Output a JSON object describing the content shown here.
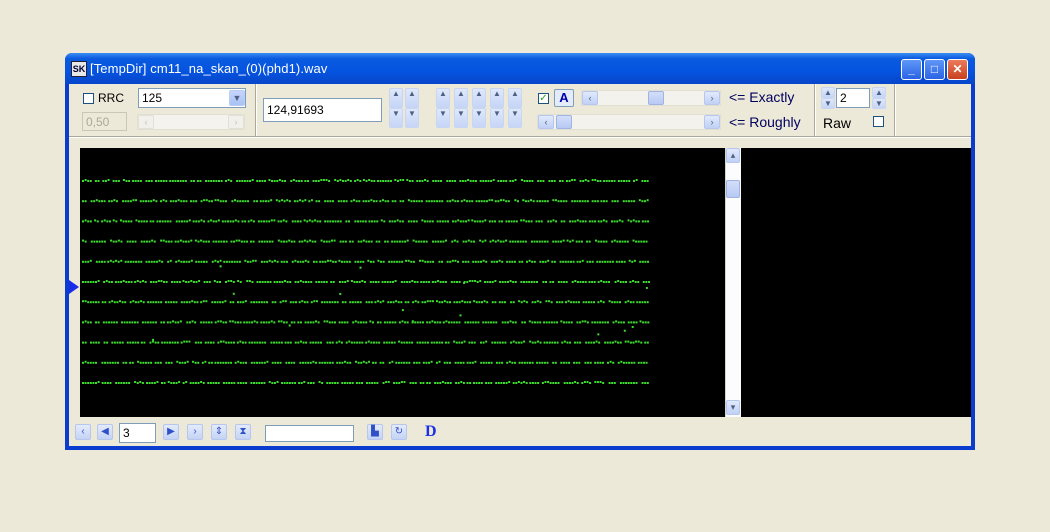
{
  "window": {
    "title": "[TempDir] cm11_na_skan_(0)(phd1).wav",
    "app_icon_text": "SK",
    "controls": {
      "minimize": "_",
      "maximize": "□",
      "close": "✕"
    }
  },
  "toolbar": {
    "rrc": {
      "label": "RRC",
      "checked": false
    },
    "rate_select": {
      "value": "125"
    },
    "rrc_value": {
      "value": "0,50"
    },
    "position_field": {
      "value": "124,91693"
    },
    "auto_checkbox": {
      "checked": true,
      "mark": "✓"
    },
    "a_button_label": "A",
    "exactly_label": "<= Exactly",
    "roughly_label": "<= Roughly",
    "count_spinner": {
      "value": "2"
    },
    "raw": {
      "label": "Raw",
      "checked": false
    }
  },
  "display": {
    "trace_color": "#3ddc2e",
    "background": "#000000",
    "marker_color": "#1a2ce8"
  },
  "bottom_bar": {
    "page_field": {
      "value": "3"
    },
    "search_field": {
      "value": ""
    },
    "d_button_label": "D"
  }
}
